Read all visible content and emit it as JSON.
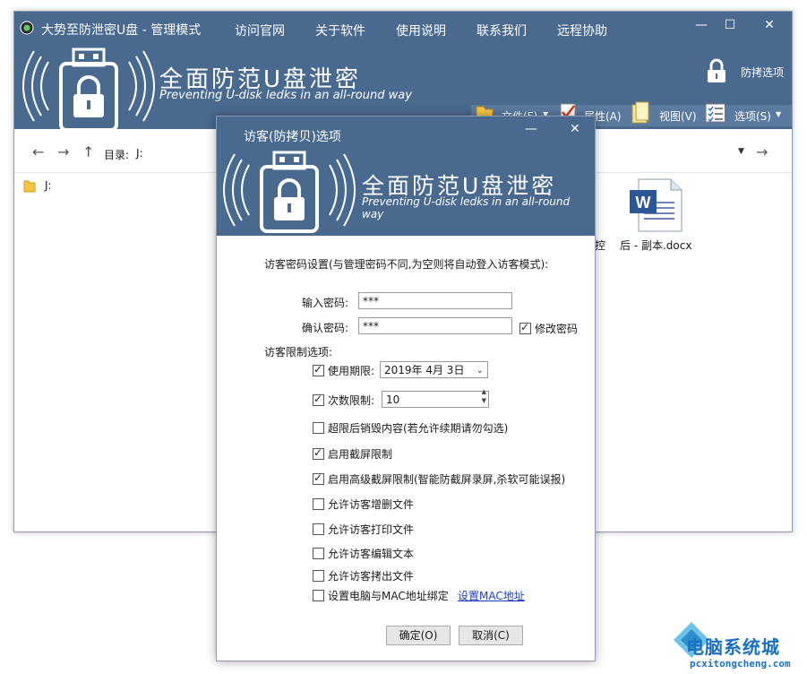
{
  "main_window": {
    "title": "大势至防泄密U盘 - 管理模式",
    "menu": [
      "访问官网",
      "关于软件",
      "使用说明",
      "联系我们",
      "远程协助"
    ],
    "brand_cn": "全面防范U盘泄密",
    "brand_en": "Preventing U-disk ledks in an all-round way",
    "copy_protect_label": "防拷选项",
    "toolbar": {
      "file": "文件(F)",
      "properties": "属性(A)",
      "view": "视图(V)",
      "options": "选项(S)"
    },
    "nav": {
      "dir_label": "目录:",
      "dir_value": "J:"
    },
    "tree_item": "J:",
    "file_items": [
      "控",
      "后 - 副本.docx"
    ]
  },
  "dialog": {
    "title": "访客(防拷贝)选项",
    "brand_cn": "全面防范U盘泄密",
    "brand_en": "Preventing U-disk ledks in an all-round way",
    "password_section": "访客密码设置(与管理密码不同,为空则将自动登入访客模式):",
    "enter_password_label": "输入密码:",
    "enter_password_value": "***",
    "confirm_password_label": "确认密码:",
    "confirm_password_value": "***",
    "change_password_label": "修改密码",
    "limits_section": "访客限制选项:",
    "expiry_label": "使用期限:",
    "expiry_value": "2019年 4月 3日",
    "count_label": "次数限制:",
    "count_value": "10",
    "options": {
      "destroy": "超限后销毁内容(若允许续期请勿勾选)",
      "screenshot": "启用截屏限制",
      "adv_screenshot": "启用高级截屏限制(智能防截屏录屏,杀软可能误报)",
      "add_delete": "允许访客增删文件",
      "print": "允许访客打印文件",
      "edit": "允许访客编辑文本",
      "copy_out": "允许访客拷出文件",
      "mac_bind": "设置电脑与MAC地址绑定"
    },
    "mac_link": "设置MAC地址",
    "ok": "确定(O)",
    "cancel": "取消(C)"
  },
  "watermark": {
    "cn": "电脑系统城",
    "url": "pcxitongcheng.com"
  }
}
